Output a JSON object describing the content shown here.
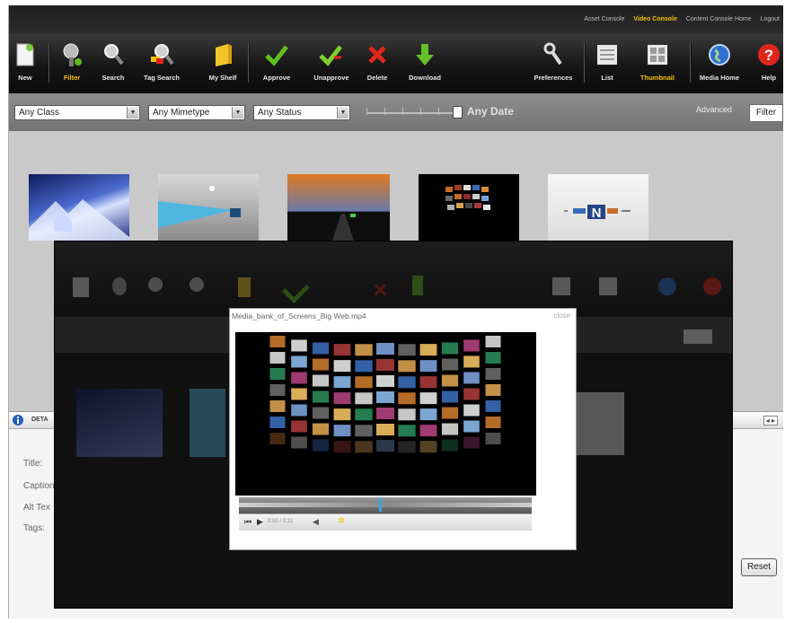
{
  "top_links": {
    "asset_console": "Asset Console",
    "video_console": "Video Console",
    "content_home": "Content Console Home",
    "logout": "Logout"
  },
  "toolbar": {
    "new": "New",
    "filter": "Filter",
    "search": "Search",
    "tag_search": "Tag Search",
    "my_shelf": "My Shelf",
    "approve": "Approve",
    "unapprove": "Unapprove",
    "delete": "Delete",
    "download": "Download",
    "preferences": "Preferences",
    "list": "List",
    "thumbnail": "Thumbnail",
    "media_home": "Media Home",
    "help": "Help"
  },
  "filters": {
    "class": "Any Class",
    "mimetype": "Any Mimetype",
    "status": "Any Status",
    "date": "Any Date",
    "advanced": "Advanced",
    "filter_button": "Filter"
  },
  "details": {
    "heading": "DETA",
    "title_label": "Title:",
    "caption_label": "Caption",
    "alt_label": "Alt Tex",
    "tags_label": "Tags:",
    "reset": "Reset"
  },
  "modal": {
    "title": "Media_bank_of_Screens_Big Web.mp4",
    "close": "close",
    "time": "0:00 / 0:31",
    "progress": 0.48
  },
  "colors": {
    "accent": "#f2c200",
    "approve": "#5fbf1e",
    "delete": "#e0261b",
    "download": "#64c02a",
    "progress_thumb": "#3aa6d6"
  }
}
